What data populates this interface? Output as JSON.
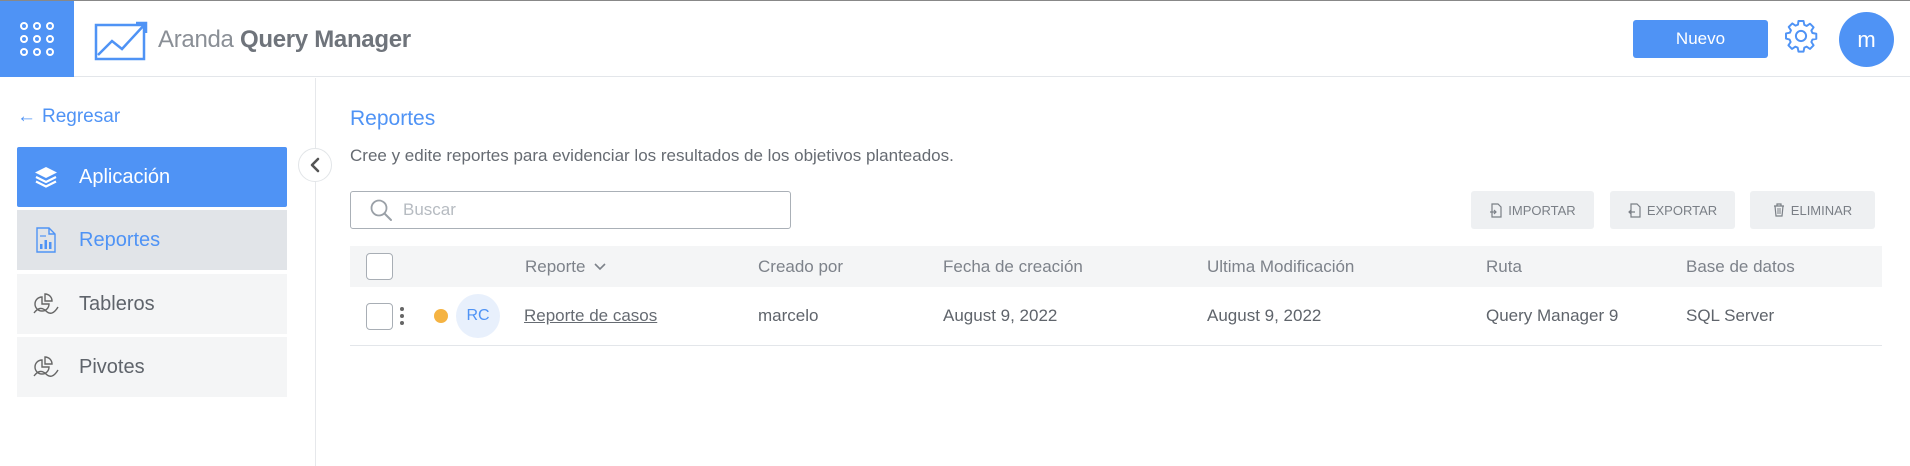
{
  "header": {
    "apps_icon": "apps-grid-icon",
    "logo_prefix": "Aranda",
    "logo_bold": "Query Manager",
    "new_label": "Nuevo",
    "settings_icon": "gear-icon",
    "user_initial": "m"
  },
  "sidebar": {
    "back_label": "Regresar",
    "items": [
      {
        "label": "Aplicación",
        "icon": "layers-icon",
        "state": "active"
      },
      {
        "label": "Reportes",
        "icon": "report-icon",
        "state": "selected"
      },
      {
        "label": "Tableros",
        "icon": "dashboard-icon",
        "state": "normal"
      },
      {
        "label": "Pivotes",
        "icon": "pivot-icon",
        "state": "normal"
      }
    ]
  },
  "main": {
    "title": "Reportes",
    "subtitle": "Cree y edite reportes para evidenciar los resultados de los objetivos planteados.",
    "search_placeholder": "Buscar",
    "actions": {
      "import": "IMPORTAR",
      "export": "EXPORTAR",
      "delete": "ELIMINAR"
    }
  },
  "table": {
    "columns": [
      "Reporte",
      "Creado por",
      "Fecha de creación",
      "Ultima Modificación",
      "Ruta",
      "Base de datos"
    ],
    "rows": [
      {
        "initials": "RC",
        "status_color": "#f5b342",
        "name": "Reporte de casos",
        "created_by": "marcelo",
        "created": "August 9, 2022",
        "modified": "August 9, 2022",
        "path": "Query Manager 9",
        "database": "SQL Server"
      }
    ]
  },
  "colors": {
    "accent": "#4f93f5",
    "status_pending": "#f5b342"
  }
}
